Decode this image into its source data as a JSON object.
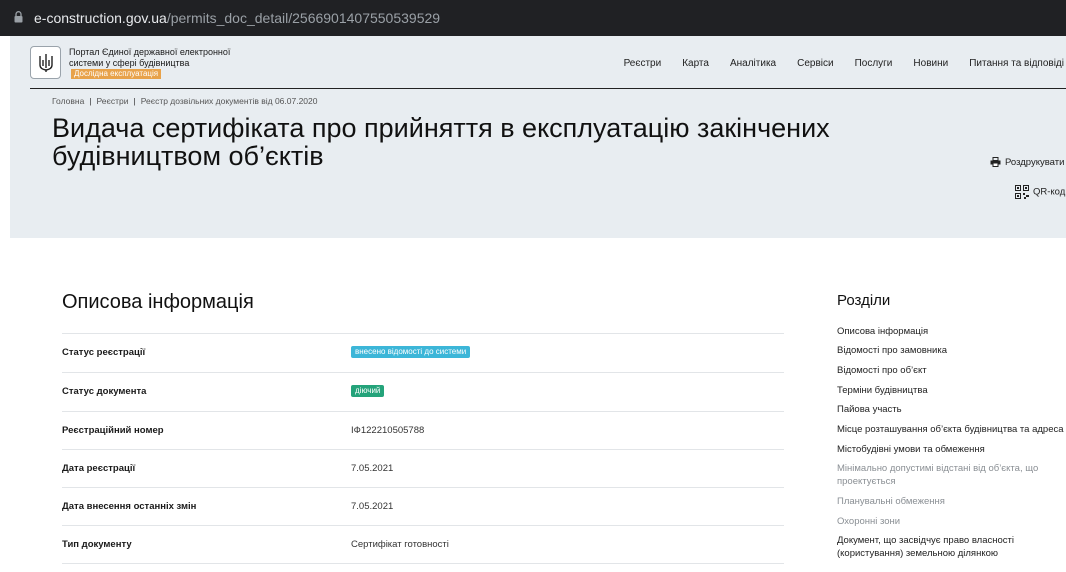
{
  "browser": {
    "url_domain": "e-construction.gov.ua",
    "url_path": "/permits_doc_detail/2566901407550539529"
  },
  "header": {
    "portal_name": "Портал Єдиної державної електронної системи у сфері будівництва",
    "beta_badge": "Дослідна експлуатація",
    "menu": [
      "Реєстри",
      "Карта",
      "Аналітика",
      "Сервіси",
      "Послуги",
      "Новини",
      "Питання та відповіді"
    ]
  },
  "breadcrumbs": [
    "Головна",
    "Реєстри",
    "Реєстр дозвільних документів від 06.07.2020"
  ],
  "page_title": "Видача сертифіката про прийняття в експлуатацію закінчених будівництвом об’єктів",
  "actions": {
    "print": "Роздрукувати",
    "qr": "QR-код"
  },
  "main": {
    "section_title": "Описова інформація",
    "rows": [
      {
        "label": "Статус реєстрації",
        "badge": "внесено відомості до системи",
        "badge_color": "#3cb6d8"
      },
      {
        "label": "Статус документа",
        "badge": "діючий",
        "badge_color": "#24a37a"
      },
      {
        "label": "Реєстраційний номер",
        "value": "ІФ122210505788"
      },
      {
        "label": "Дата реєстрації",
        "value": "7.05.2021"
      },
      {
        "label": "Дата внесення останніх змін",
        "value": "7.05.2021"
      },
      {
        "label": "Тип документу",
        "value": "Сертифікат готовності"
      }
    ]
  },
  "sidebar": {
    "title": "Розділи",
    "items": [
      {
        "label": "Описова інформація",
        "muted": false
      },
      {
        "label": "Відомості про замовника",
        "muted": false
      },
      {
        "label": "Відомості про об’єкт",
        "muted": false
      },
      {
        "label": "Терміни будівництва",
        "muted": false
      },
      {
        "label": "Пайова участь",
        "muted": false
      },
      {
        "label": "Місце розташування об’єкта будівництва та адреса",
        "muted": false
      },
      {
        "label": "Містобудівні умови та обмеження",
        "muted": false
      },
      {
        "label": "Мінімально допустимі відстані від об’єкта, що проектується",
        "muted": true
      },
      {
        "label": "Планувальні обмеження",
        "muted": true
      },
      {
        "label": "Охоронні зони",
        "muted": true
      },
      {
        "label": "Документ, що засвідчує право власності (користування) земельною ділянкою",
        "muted": false
      }
    ]
  }
}
